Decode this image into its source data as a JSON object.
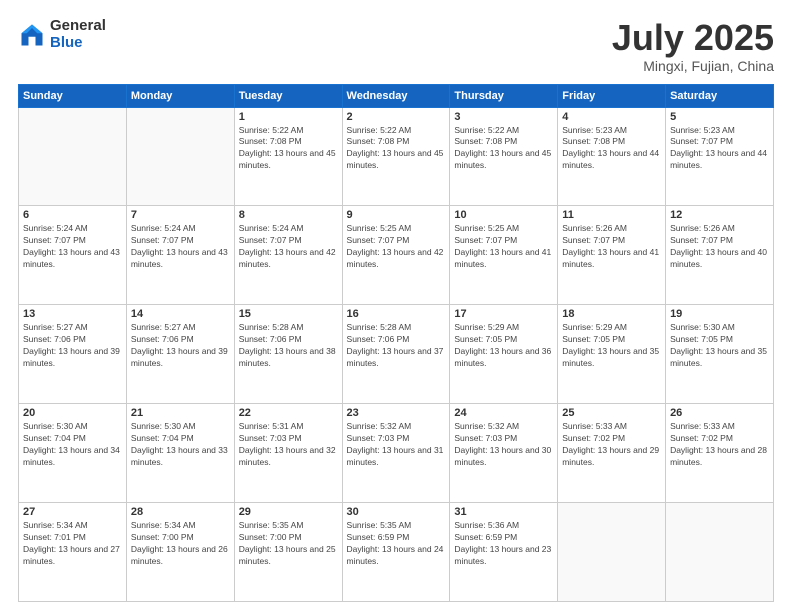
{
  "header": {
    "logo_general": "General",
    "logo_blue": "Blue",
    "month_title": "July 2025",
    "location": "Mingxi, Fujian, China"
  },
  "weekdays": [
    "Sunday",
    "Monday",
    "Tuesday",
    "Wednesday",
    "Thursday",
    "Friday",
    "Saturday"
  ],
  "weeks": [
    [
      {
        "day": "",
        "info": ""
      },
      {
        "day": "",
        "info": ""
      },
      {
        "day": "1",
        "info": "Sunrise: 5:22 AM\nSunset: 7:08 PM\nDaylight: 13 hours and 45 minutes."
      },
      {
        "day": "2",
        "info": "Sunrise: 5:22 AM\nSunset: 7:08 PM\nDaylight: 13 hours and 45 minutes."
      },
      {
        "day": "3",
        "info": "Sunrise: 5:22 AM\nSunset: 7:08 PM\nDaylight: 13 hours and 45 minutes."
      },
      {
        "day": "4",
        "info": "Sunrise: 5:23 AM\nSunset: 7:08 PM\nDaylight: 13 hours and 44 minutes."
      },
      {
        "day": "5",
        "info": "Sunrise: 5:23 AM\nSunset: 7:07 PM\nDaylight: 13 hours and 44 minutes."
      }
    ],
    [
      {
        "day": "6",
        "info": "Sunrise: 5:24 AM\nSunset: 7:07 PM\nDaylight: 13 hours and 43 minutes."
      },
      {
        "day": "7",
        "info": "Sunrise: 5:24 AM\nSunset: 7:07 PM\nDaylight: 13 hours and 43 minutes."
      },
      {
        "day": "8",
        "info": "Sunrise: 5:24 AM\nSunset: 7:07 PM\nDaylight: 13 hours and 42 minutes."
      },
      {
        "day": "9",
        "info": "Sunrise: 5:25 AM\nSunset: 7:07 PM\nDaylight: 13 hours and 42 minutes."
      },
      {
        "day": "10",
        "info": "Sunrise: 5:25 AM\nSunset: 7:07 PM\nDaylight: 13 hours and 41 minutes."
      },
      {
        "day": "11",
        "info": "Sunrise: 5:26 AM\nSunset: 7:07 PM\nDaylight: 13 hours and 41 minutes."
      },
      {
        "day": "12",
        "info": "Sunrise: 5:26 AM\nSunset: 7:07 PM\nDaylight: 13 hours and 40 minutes."
      }
    ],
    [
      {
        "day": "13",
        "info": "Sunrise: 5:27 AM\nSunset: 7:06 PM\nDaylight: 13 hours and 39 minutes."
      },
      {
        "day": "14",
        "info": "Sunrise: 5:27 AM\nSunset: 7:06 PM\nDaylight: 13 hours and 39 minutes."
      },
      {
        "day": "15",
        "info": "Sunrise: 5:28 AM\nSunset: 7:06 PM\nDaylight: 13 hours and 38 minutes."
      },
      {
        "day": "16",
        "info": "Sunrise: 5:28 AM\nSunset: 7:06 PM\nDaylight: 13 hours and 37 minutes."
      },
      {
        "day": "17",
        "info": "Sunrise: 5:29 AM\nSunset: 7:05 PM\nDaylight: 13 hours and 36 minutes."
      },
      {
        "day": "18",
        "info": "Sunrise: 5:29 AM\nSunset: 7:05 PM\nDaylight: 13 hours and 35 minutes."
      },
      {
        "day": "19",
        "info": "Sunrise: 5:30 AM\nSunset: 7:05 PM\nDaylight: 13 hours and 35 minutes."
      }
    ],
    [
      {
        "day": "20",
        "info": "Sunrise: 5:30 AM\nSunset: 7:04 PM\nDaylight: 13 hours and 34 minutes."
      },
      {
        "day": "21",
        "info": "Sunrise: 5:30 AM\nSunset: 7:04 PM\nDaylight: 13 hours and 33 minutes."
      },
      {
        "day": "22",
        "info": "Sunrise: 5:31 AM\nSunset: 7:03 PM\nDaylight: 13 hours and 32 minutes."
      },
      {
        "day": "23",
        "info": "Sunrise: 5:32 AM\nSunset: 7:03 PM\nDaylight: 13 hours and 31 minutes."
      },
      {
        "day": "24",
        "info": "Sunrise: 5:32 AM\nSunset: 7:03 PM\nDaylight: 13 hours and 30 minutes."
      },
      {
        "day": "25",
        "info": "Sunrise: 5:33 AM\nSunset: 7:02 PM\nDaylight: 13 hours and 29 minutes."
      },
      {
        "day": "26",
        "info": "Sunrise: 5:33 AM\nSunset: 7:02 PM\nDaylight: 13 hours and 28 minutes."
      }
    ],
    [
      {
        "day": "27",
        "info": "Sunrise: 5:34 AM\nSunset: 7:01 PM\nDaylight: 13 hours and 27 minutes."
      },
      {
        "day": "28",
        "info": "Sunrise: 5:34 AM\nSunset: 7:00 PM\nDaylight: 13 hours and 26 minutes."
      },
      {
        "day": "29",
        "info": "Sunrise: 5:35 AM\nSunset: 7:00 PM\nDaylight: 13 hours and 25 minutes."
      },
      {
        "day": "30",
        "info": "Sunrise: 5:35 AM\nSunset: 6:59 PM\nDaylight: 13 hours and 24 minutes."
      },
      {
        "day": "31",
        "info": "Sunrise: 5:36 AM\nSunset: 6:59 PM\nDaylight: 13 hours and 23 minutes."
      },
      {
        "day": "",
        "info": ""
      },
      {
        "day": "",
        "info": ""
      }
    ]
  ]
}
